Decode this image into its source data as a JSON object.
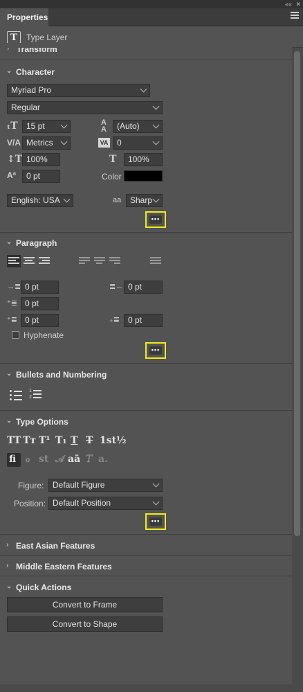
{
  "window": {
    "collapse_glyph": "««",
    "close_glyph": "✕"
  },
  "tab": {
    "label": "Properties"
  },
  "layer": {
    "type_label": "Type Layer",
    "icon": "T"
  },
  "sections": {
    "transform": "Transform",
    "character": "Character",
    "paragraph": "Paragraph",
    "bullets": "Bullets and Numbering",
    "type_options": "Type Options",
    "east_asian": "East Asian Features",
    "middle_eastern": "Middle Eastern Features",
    "quick_actions": "Quick Actions"
  },
  "character": {
    "font_family": "Myriad Pro",
    "font_style": "Regular",
    "font_size": "15 pt",
    "leading": "(Auto)",
    "kerning": "Metrics",
    "tracking": "0",
    "vertical_scale": "100%",
    "horizontal_scale": "100%",
    "baseline_shift": "0 pt",
    "color_label": "Color",
    "color_value": "#000000",
    "language": "English: USA",
    "antialias_icon_text": "aa",
    "antialias": "Sharp"
  },
  "paragraph": {
    "indent_left": "0 pt",
    "indent_right": "0 pt",
    "indent_first": "0 pt",
    "space_before": "0 pt",
    "space_after": "0 pt",
    "hyphenate_label": "Hyphenate",
    "hyphenate_checked": false
  },
  "type_options": {
    "style_glyphs": [
      "TT",
      "Tт",
      "T¹",
      "T₁",
      "T",
      "T",
      "1st",
      "½"
    ],
    "ot_glyphs": [
      "fi",
      "ℴ",
      "st",
      "𝒜",
      "aā",
      "𝑇",
      "a."
    ],
    "figure_label": "Figure:",
    "figure_value": "Default Figure",
    "position_label": "Position:",
    "position_value": "Default Position"
  },
  "quick_actions": {
    "convert_frame": "Convert to Frame",
    "convert_shape": "Convert to Shape"
  },
  "more_glyph": "•••",
  "colors": {
    "highlight": "#f2ec1c",
    "panel": "#535353",
    "field": "#3e3e3e"
  }
}
